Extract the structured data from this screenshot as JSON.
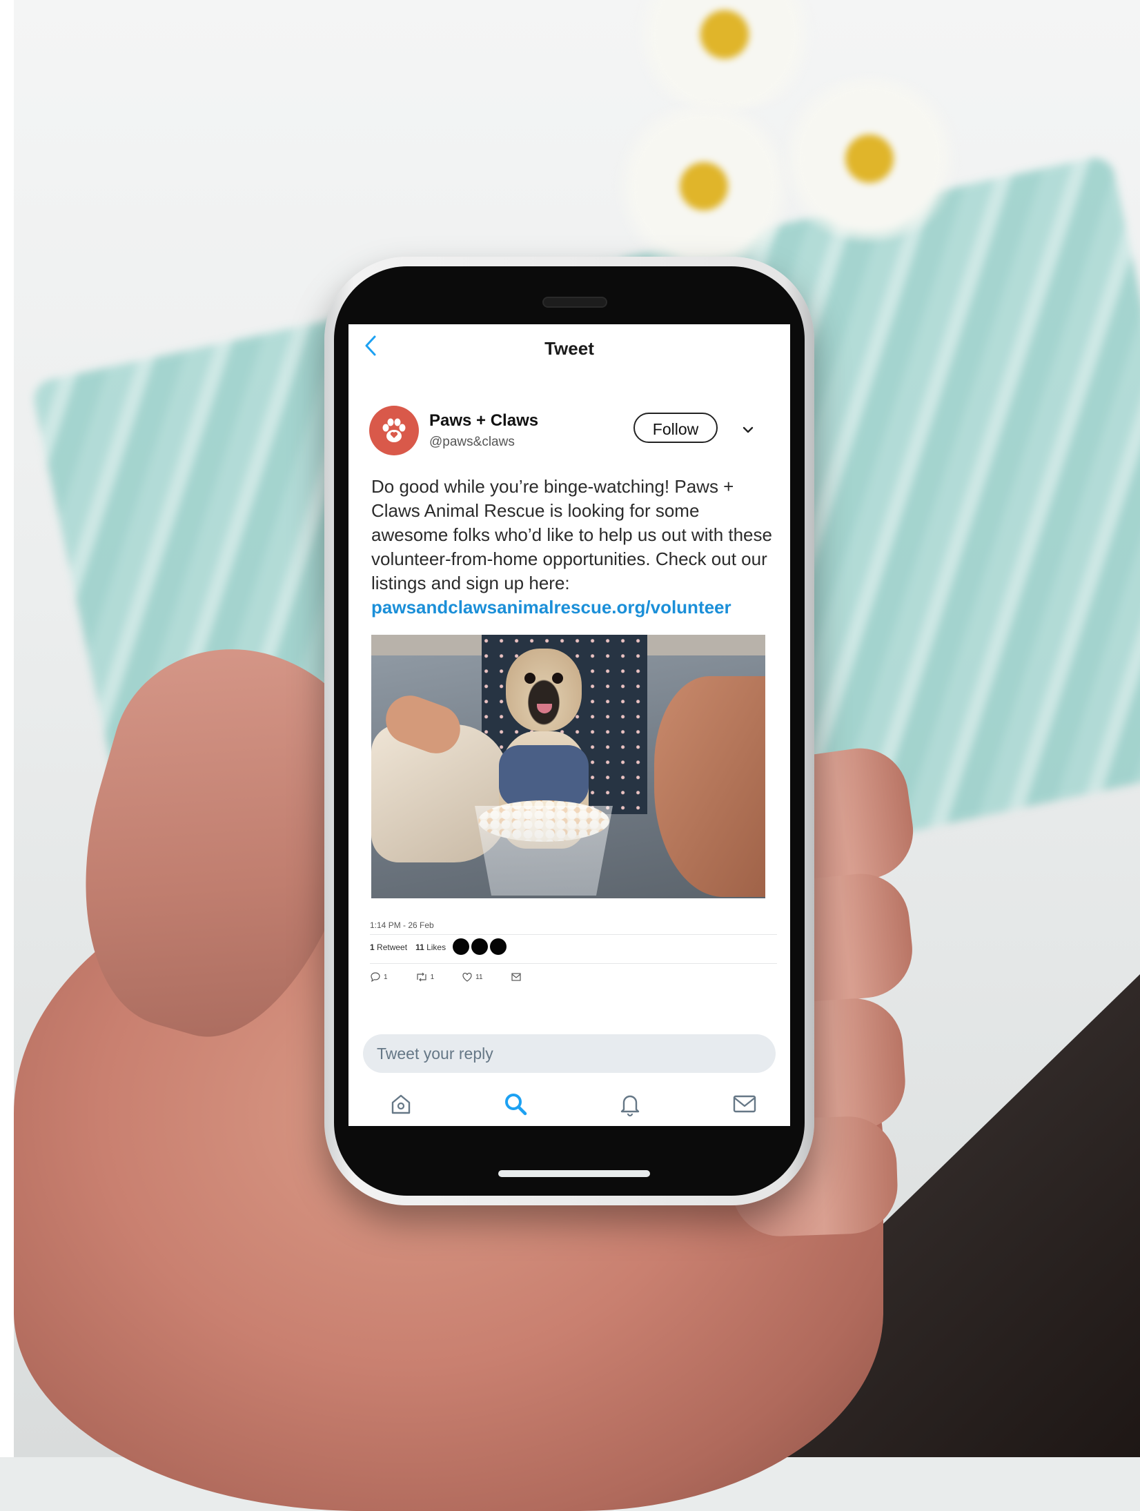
{
  "nav": {
    "back_icon": "chevron-left-icon",
    "title": "Tweet"
  },
  "author": {
    "name": "Paws + Claws",
    "handle": "@paws&claws",
    "avatar_icon": "paw-icon",
    "avatar_color": "#d9594a"
  },
  "follow_label": "Follow",
  "more_icon": "chevron-down-icon",
  "tweet": {
    "text": "Do good while you’re binge-watching! Paws + Claws Animal Rescue is looking for some awesome folks who’d like to help us out with these volunteer-from-home opportunities. Check out our listings and sign up here:",
    "link": "pawsandclawsanimalrescue.org/volunteer"
  },
  "timestamp": "1:14 PM - 26 Feb",
  "stats": {
    "retweet_count": "1",
    "retweet_label": "Retweet",
    "like_count": "11",
    "like_label": "Likes"
  },
  "actions": {
    "reply": "1",
    "retweet": "1",
    "like": "11"
  },
  "reply_placeholder": "Tweet your reply",
  "tabs": [
    "home-icon",
    "search-icon",
    "bell-icon",
    "mail-icon"
  ],
  "colors": {
    "accent": "#1da1f2",
    "link": "#1b8fd8",
    "reply_bg": "#e7ebef"
  }
}
